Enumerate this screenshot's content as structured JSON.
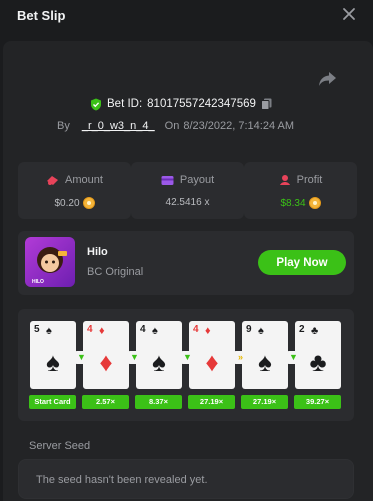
{
  "header": {
    "title": "Bet Slip"
  },
  "bet": {
    "id_label": "Bet ID:",
    "id_value": "81017557242347569",
    "by_label": "By",
    "user": "_r_0_w3_n_4_",
    "on_label": "On",
    "datetime": "8/23/2022, 7:14:24 AM"
  },
  "stats": {
    "amount_label": "Amount",
    "amount_value": "$0.20",
    "payout_label": "Payout",
    "payout_value": "42.5416 x",
    "profit_label": "Profit",
    "profit_value": "$8.34"
  },
  "game": {
    "name": "Hilo",
    "provider": "BC Original",
    "play_label": "Play Now",
    "thumb_text": "HILO"
  },
  "cards": [
    {
      "rank": "5",
      "suit": "♠",
      "color": "black"
    },
    {
      "rank": "4",
      "suit": "♦",
      "color": "red"
    },
    {
      "rank": "4",
      "suit": "♠",
      "color": "black"
    },
    {
      "rank": "4",
      "suit": "♦",
      "color": "red"
    },
    {
      "rank": "9",
      "suit": "♠",
      "color": "black"
    },
    {
      "rank": "2",
      "suit": "♣",
      "color": "black"
    }
  ],
  "arrows": [
    {
      "symbol": "▼",
      "color": "green"
    },
    {
      "symbol": "▼",
      "color": "green"
    },
    {
      "symbol": "▼",
      "color": "green"
    },
    {
      "symbol": "»",
      "color": "gold"
    },
    {
      "symbol": "▼",
      "color": "green"
    }
  ],
  "multipliers": [
    "Start Card",
    "2.57×",
    "8.37×",
    "27.19×",
    "27.19×",
    "39.27×"
  ],
  "seed": {
    "label": "Server Seed",
    "value": "The seed hasn't been revealed yet."
  },
  "colors": {
    "accent": "#3bc117",
    "panel": "#232426",
    "card": "#2b2c2f"
  }
}
